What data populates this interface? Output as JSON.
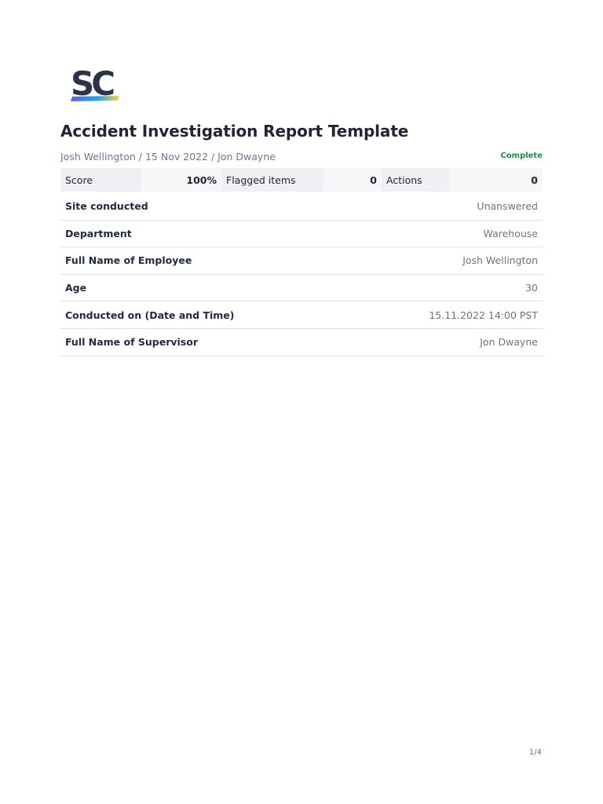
{
  "logo": {
    "text": "SC",
    "colors": [
      "#2b3446",
      "#6559f5",
      "#1aa7ec",
      "#ffd234"
    ]
  },
  "document": {
    "title": "Accident Investigation Report Template",
    "meta": "Josh Wellington / 15 Nov 2022 / Jon Dwayne",
    "status": "Complete",
    "status_color": "#1f8a4c"
  },
  "summary": {
    "score_label": "Score",
    "score_value": "100%",
    "flagged_label": "Flagged items",
    "flagged_value": "0",
    "actions_label": "Actions",
    "actions_value": "0"
  },
  "fields": [
    {
      "label": "Site conducted",
      "value": "Unanswered"
    },
    {
      "label": "Department",
      "value": "Warehouse"
    },
    {
      "label": "Full Name of Employee",
      "value": "Josh Wellington"
    },
    {
      "label": "Age",
      "value": "30"
    },
    {
      "label": "Conducted on (Date and Time)",
      "value": "15.11.2022 14:00 PST"
    },
    {
      "label": "Full Name of Supervisor",
      "value": "Jon Dwayne"
    }
  ],
  "footer": {
    "page_number": "1/4"
  }
}
